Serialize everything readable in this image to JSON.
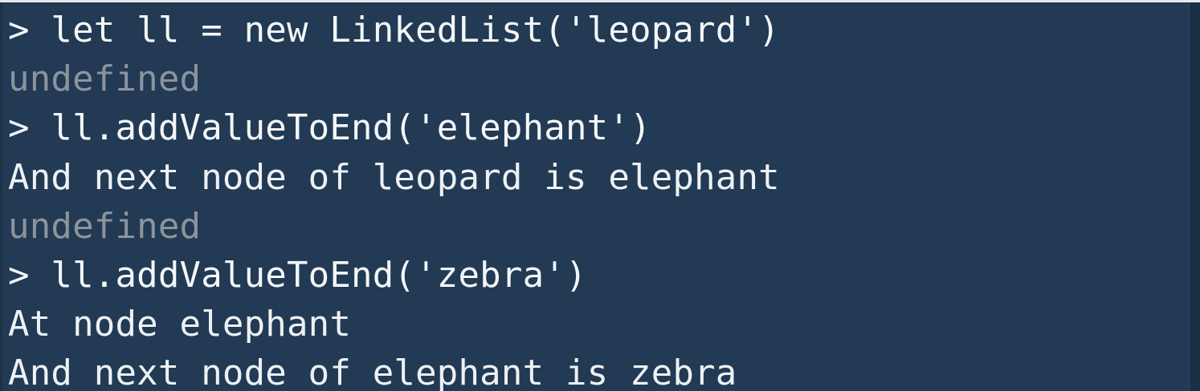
{
  "terminal": {
    "lines": [
      {
        "text": "> let ll = new LinkedList('leopard')",
        "kind": "input"
      },
      {
        "text": "undefined",
        "kind": "result"
      },
      {
        "text": "> ll.addValueToEnd('elephant')",
        "kind": "input"
      },
      {
        "text": "And next node of leopard is elephant",
        "kind": "output-text"
      },
      {
        "text": "undefined",
        "kind": "result"
      },
      {
        "text": "> ll.addValueToEnd('zebra')",
        "kind": "input"
      },
      {
        "text": "At node elephant",
        "kind": "output-text"
      },
      {
        "text": "And next node of elephant is zebra",
        "kind": "output-text"
      }
    ]
  },
  "colors": {
    "background": "#223a54",
    "text": "#f1f3f5",
    "muted": "#8c949c"
  }
}
